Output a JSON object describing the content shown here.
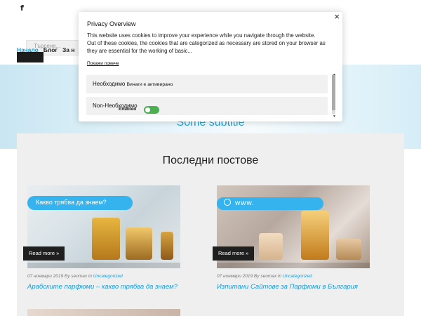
{
  "header": {
    "facebook_icon_glyph": "f",
    "search_placeholder": "Търсене..."
  },
  "nav": {
    "items": [
      "Начало",
      "Блог",
      "За н"
    ]
  },
  "hero": {
    "subtitle": "Some subtitle"
  },
  "main": {
    "section_title": "Последни постове",
    "posts": [
      {
        "bubble_text": "Какво трябва да знаем?",
        "read_more": "Read more »",
        "date": "07 ноември 2019",
        "author": "seomax",
        "category": "Uncategorized",
        "title": "Арабските парфюми – какво трябва да знаем?"
      },
      {
        "bubble_text": "www.",
        "read_more": "Read more »",
        "date": "07 ноември 2019",
        "author": "seomax",
        "category": "Uncategorized",
        "title": "Изпитани Сайтове за Парфюми в България"
      }
    ]
  },
  "privacy_modal": {
    "title": "Privacy Overview",
    "body": "This website uses cookies to improve your experience while you navigate through the website. Out of these cookies, the cookies that are categorized as necessary are stored on your browser as they are essential for the working of basic...",
    "show_more": "Покажи повече",
    "rows": [
      {
        "label": "Необходимо",
        "note": "Винаги е активирано"
      },
      {
        "label": "Non-Необходимо"
      }
    ],
    "enabled_label": "Enabled",
    "close_glyph": "×",
    "toggle_on": true
  },
  "colors": {
    "accent": "#1a9bd7",
    "bubble": "#34b3ee",
    "toggle": "#4caf50"
  }
}
